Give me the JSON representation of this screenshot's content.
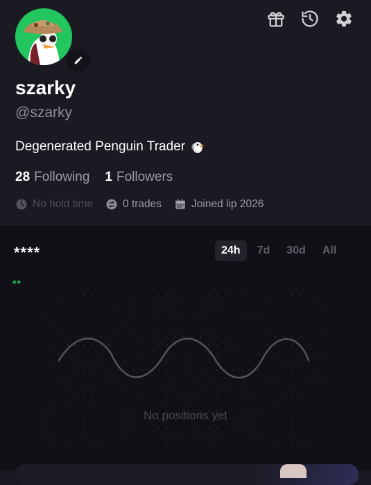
{
  "profile": {
    "username": "szarky",
    "handle": "@szarky",
    "bio": "Degenerated Penguin Trader",
    "following_count": "28",
    "following_label": "Following",
    "followers_count": "1",
    "followers_label": "Followers",
    "hold_time": "No hold time",
    "trades": "0 trades",
    "joined": "Joined lip 2026"
  },
  "header_icons": [
    "gift-icon",
    "history-icon",
    "settings-icon"
  ],
  "portfolio": {
    "title": "****",
    "pnl": "**",
    "tabs": [
      {
        "label": "24h",
        "active": true
      },
      {
        "label": "7d",
        "active": false
      },
      {
        "label": "30d",
        "active": false
      },
      {
        "label": "All",
        "active": false
      }
    ],
    "empty_message": "No positions yet"
  },
  "colors": {
    "accent_green": "#22c55e",
    "background": "#1b1a22",
    "panel_background": "#111016",
    "muted_text": "#9c9ba4"
  }
}
